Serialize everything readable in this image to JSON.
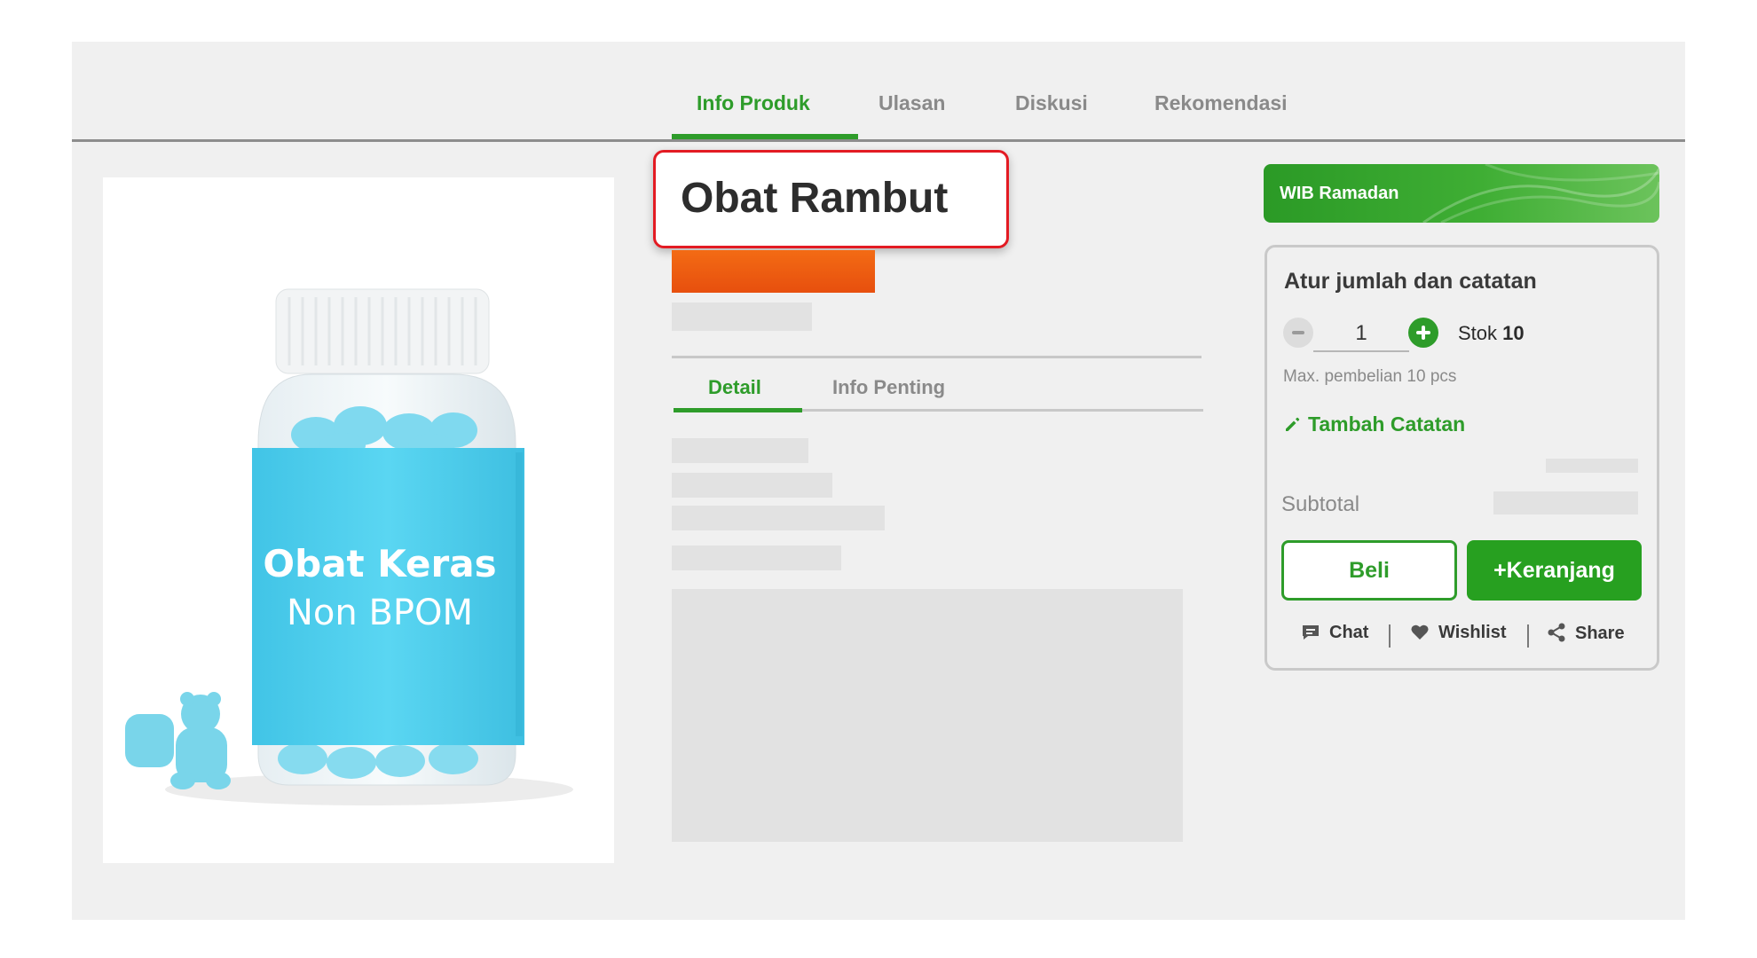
{
  "tabs": [
    "Info Produk",
    "Ulasan",
    "Diskusi",
    "Rekomendasi"
  ],
  "product": {
    "title": "Obat Rambut",
    "image_label_line1": "Obat Keras",
    "image_label_line2": "Non BPOM"
  },
  "detail_tabs": [
    "Detail",
    "Info Penting"
  ],
  "promo": {
    "label": "WIB Ramadan"
  },
  "cart": {
    "title": "Atur jumlah dan catatan",
    "quantity": "1",
    "stock_label": "Stok",
    "stock_value": "10",
    "max_purchase": "Max. pembelian 10 pcs",
    "add_note": "Tambah Catatan",
    "subtotal_label": "Subtotal",
    "buy_button": "Beli",
    "add_to_cart_button": "+Keranjang"
  },
  "actions": [
    "Chat",
    "Wishlist",
    "Share"
  ],
  "colors": {
    "accent": "#2e9c2a",
    "price": "#f36b14",
    "highlight_border": "#e31b23",
    "label_cyan": "#4fd0ee"
  }
}
